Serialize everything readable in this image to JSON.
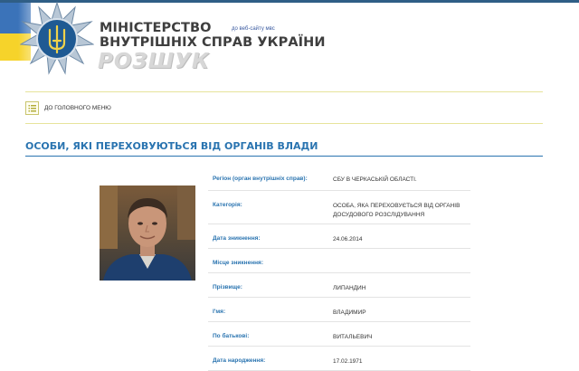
{
  "header": {
    "title_line1": "Міністерство",
    "title_line2": "внутрішніх справ України",
    "section": "РОЗШУК",
    "old_site_link": "до веб-сайту мвс"
  },
  "menu": {
    "main_menu_label": "до головного меню"
  },
  "page": {
    "heading": "ОСОБИ, ЯКІ ПЕРЕХОВУЮТЬСЯ ВІД ОРГАНІВ ВЛАДИ"
  },
  "person": {
    "rows": [
      {
        "label": "Регіон (орган внутрішніх справ):",
        "value": "СБУ в Черкаській області."
      },
      {
        "label": "Категорія:",
        "value": "Особа, яка переховується від органів досудового розслідування"
      },
      {
        "label": "Дата зникнення:",
        "value": "24.06.2014"
      },
      {
        "label": "Місце зникнення:",
        "value": ""
      },
      {
        "label": "Прізвище:",
        "value": "ЛИПАНДИН"
      },
      {
        "label": "І'мя:",
        "value": "ВЛАДИМИР"
      },
      {
        "label": "По батькові:",
        "value": "ВИТАЛЬЕВИЧ"
      },
      {
        "label": "Дата народження:",
        "value": "17.02.1971"
      }
    ]
  },
  "colors": {
    "accent_blue": "#2a74b0",
    "flag_blue": "#3b73b9",
    "flag_yellow": "#f6d32a",
    "menu_rule": "#e7e49b"
  },
  "icons": {
    "emblem": "police-star-trident-emblem",
    "menu": "list-menu-icon"
  }
}
